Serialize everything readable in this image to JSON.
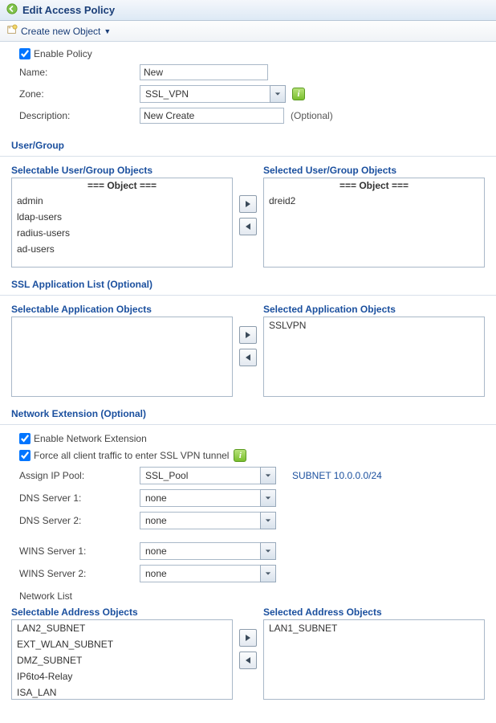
{
  "titlebar": {
    "title": "Edit Access Policy"
  },
  "toolbar": {
    "create_label": "Create new Object"
  },
  "form": {
    "enable_label": "Enable Policy",
    "name_label": "Name:",
    "name_value": "New",
    "zone_label": "Zone:",
    "zone_value": "SSL_VPN",
    "desc_label": "Description:",
    "desc_value": "New Create",
    "optional_text": "(Optional)"
  },
  "usergroup": {
    "section_title": "User/Group",
    "selectable_label": "Selectable User/Group Objects",
    "selected_label": "Selected User/Group Objects",
    "object_header": "=== Object ===",
    "selectable_items": [
      "admin",
      "ldap-users",
      "radius-users",
      "ad-users"
    ],
    "selected_items": [
      "dreid2"
    ]
  },
  "sslapp": {
    "section_title": "SSL Application List (Optional)",
    "selectable_label": "Selectable Application Objects",
    "selected_label": "Selected Application Objects",
    "selectable_items": [],
    "selected_items": [
      "SSLVPN"
    ]
  },
  "netext": {
    "section_title": "Network Extension (Optional)",
    "enable_label": "Enable Network Extension",
    "force_label": "Force all client traffic to enter SSL VPN tunnel",
    "assign_pool_label": "Assign IP Pool:",
    "assign_pool_value": "SSL_Pool",
    "subnet_text": "SUBNET 10.0.0.0/24",
    "dns1_label": "DNS Server 1:",
    "dns1_value": "none",
    "dns2_label": "DNS Server 2:",
    "dns2_value": "none",
    "wins1_label": "WINS Server 1:",
    "wins1_value": "none",
    "wins2_label": "WINS Server 2:",
    "wins2_value": "none",
    "network_list_label": "Network List",
    "selectable_label": "Selectable Address Objects",
    "selected_label": "Selected Address Objects",
    "selectable_items": [
      "LAN2_SUBNET",
      "EXT_WLAN_SUBNET",
      "DMZ_SUBNET",
      "IP6to4-Relay",
      "ISA_LAN"
    ],
    "selected_items": [
      "LAN1_SUBNET"
    ]
  }
}
